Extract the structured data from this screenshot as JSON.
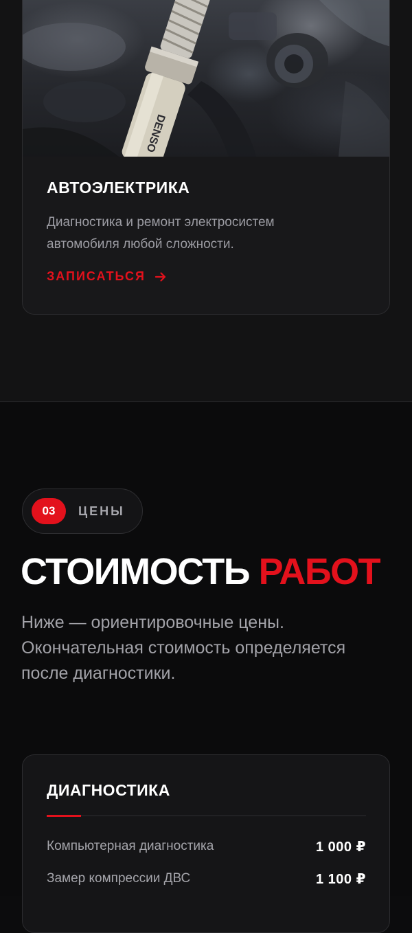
{
  "services": {
    "card": {
      "title": "АВТОЭЛЕКТРИКА",
      "description": "Диагностика и ремонт электросистем автомобиля любой сложности.",
      "cta_label": "ЗАПИСАТЬСЯ",
      "photo_icon": "spark-plug-photo"
    }
  },
  "prices": {
    "badge": {
      "number": "03",
      "label": "ЦЕНЫ"
    },
    "title_part1": "СТОИМОСТЬ",
    "title_part2": "РАБОТ",
    "lead": "Ниже — ориентировочные цены. Окончательная стоимость определяется после диагностики.",
    "card": {
      "title": "ДИАГНОСТИКА",
      "rows": [
        {
          "name": "Компьютерная диагностика",
          "price": "1 000 ₽"
        },
        {
          "name": "Замер компрессии ДВС",
          "price": "1 100 ₽"
        }
      ]
    }
  },
  "colors": {
    "accent": "#e3111c",
    "background": "#0b0b0c",
    "card": "#18181a",
    "text_muted": "#9c9ca3"
  }
}
